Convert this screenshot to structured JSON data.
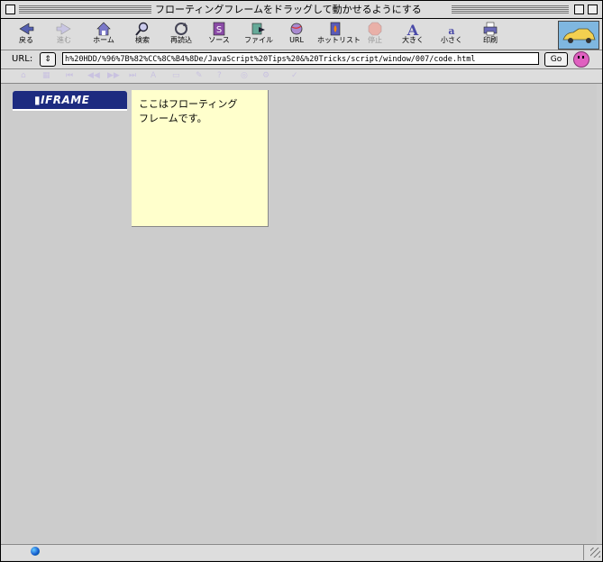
{
  "window": {
    "title": "フローティングフレームをドラッグして動かせるようにする"
  },
  "toolbar": {
    "buttons": [
      {
        "label": "戻る",
        "icon": "back-arrow-icon",
        "enabled": true
      },
      {
        "label": "進む",
        "icon": "forward-arrow-icon",
        "enabled": false
      },
      {
        "label": "ホーム",
        "icon": "home-icon",
        "enabled": true
      },
      {
        "label": "検索",
        "icon": "search-icon",
        "enabled": true
      },
      {
        "label": "再読込",
        "icon": "reload-icon",
        "enabled": true
      },
      {
        "label": "ソース",
        "icon": "source-icon",
        "enabled": true
      },
      {
        "label": "ファイル",
        "icon": "file-icon",
        "enabled": true
      },
      {
        "label": "URL",
        "icon": "url-globe-icon",
        "enabled": true
      },
      {
        "label": "ホットリスト",
        "icon": "hotlist-icon",
        "enabled": true
      },
      {
        "label": "停止",
        "icon": "stop-icon",
        "enabled": false
      },
      {
        "label": "大きく",
        "icon": "font-larger-icon",
        "enabled": true
      },
      {
        "label": "小さく",
        "icon": "font-smaller-icon",
        "enabled": true
      },
      {
        "label": "印刷",
        "icon": "print-icon",
        "enabled": true
      }
    ]
  },
  "urlbar": {
    "label": "URL:",
    "value": "h%20HDD/%96%7B%82%CC%8C%B4%8De/JavaScript%20Tips%20&%20Tricks/script/window/007/code.html",
    "go_label": "Go"
  },
  "content": {
    "badge_text": "IFRAME",
    "frame_text": "ここはフローティングフレームです。",
    "frame_bg": "#ffffcc",
    "badge_bg": "#1d2b80"
  }
}
